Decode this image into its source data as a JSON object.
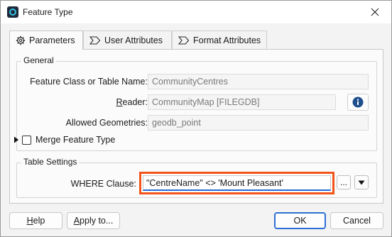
{
  "window": {
    "title": "Feature Type",
    "close_icon": "close-icon",
    "app_icon": "fme-app-icon"
  },
  "tabs": [
    {
      "label": "Parameters",
      "icon": "gear-icon",
      "active": true
    },
    {
      "label": "User Attributes",
      "icon": "attribute-tab-icon",
      "active": false
    },
    {
      "label": "Format Attributes",
      "icon": "attribute-tab-icon",
      "active": false
    }
  ],
  "general": {
    "title": "General",
    "feature_class_label": "Feature Class or Table Name:",
    "feature_class_value": "CommunityCentres",
    "reader_label": "Reader:",
    "reader_value": "CommunityMap [FILEGDB]",
    "reader_info_icon": "info-icon",
    "allowed_geometries_label": "Allowed Geometries:",
    "allowed_geometries_value": "geodb_point",
    "merge_label": "Merge Feature Type",
    "merge_checked": false
  },
  "table_settings": {
    "title": "Table Settings",
    "where_label": "WHERE Clause:",
    "where_value": "\"CentreName\" <> 'Mount Pleasant'",
    "ellipsis_label": "...",
    "dropdown_icon": "triangle-down-icon",
    "highlight_color": "#f2541b"
  },
  "footer": {
    "help_label": "Help",
    "apply_label": "Apply to...",
    "ok_label": "OK",
    "cancel_label": "Cancel"
  }
}
